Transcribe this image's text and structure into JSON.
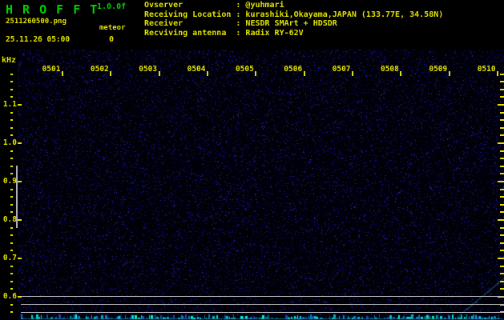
{
  "app": {
    "name": "H R O F F T",
    "version": "1.0.0f"
  },
  "capture": {
    "filename": "2511260500.png",
    "timestamp": "25.11.26 05:00",
    "meteor_label": "meteor",
    "meteor_count": "0"
  },
  "observation": {
    "separator": ":",
    "rows": [
      {
        "label": "Ovserver",
        "value": "@yuhmari"
      },
      {
        "label": "Receiving Location",
        "value": "kurashiki,Okayama,JAPAN (133.77E, 34.58N)"
      },
      {
        "label": "Receiver",
        "value": "NESDR SMArt + HDSDR"
      },
      {
        "label": "Recviving antenna",
        "value": "Radix RY-62V"
      }
    ]
  },
  "axis": {
    "unit_label": "kHz",
    "freq_ticks": [
      "1.1",
      "1.0",
      "0.9",
      "0.8",
      "0.7",
      "0.6"
    ],
    "time_ticks": [
      "0501",
      "0502",
      "0503",
      "0504",
      "0505",
      "0506",
      "0507",
      "0508",
      "0509",
      "0510"
    ]
  },
  "colors": {
    "background": "#000000",
    "text_yellow": "#e0e000",
    "text_green": "#00d000",
    "noise_blue": "#2222aa",
    "carrier_gray": "#b8b8b8",
    "level_cyan": "#00d8d8"
  },
  "chart_data": {
    "type": "heatmap",
    "title": "HROFFT radio meteor echo spectrogram 2511260500",
    "ylabel": "kHz",
    "y_ticks_khz": [
      1.1,
      1.0,
      0.9,
      0.8,
      0.7,
      0.6
    ],
    "y_range_khz": [
      0.55,
      1.19
    ],
    "x_tick_labels": [
      "0501",
      "0502",
      "0503",
      "0504",
      "0505",
      "0506",
      "0507",
      "0508",
      "0509",
      "0510"
    ],
    "time_start": "05:01",
    "time_end": "05:10",
    "date": "2025-11-26",
    "meteor_echo_count": 0,
    "carrier_lines_khz": [
      0.603,
      0.581,
      0.56
    ],
    "content_notes": [
      "uniform dark-blue background noise field, no meteor echoes visible",
      "three faint horizontal gray carrier lines near 0.6 kHz",
      "cyan noise-level bar strip along bottom edge",
      "faint diagonal blue doppler trace in bottom-right corner",
      "gray vertical level scale bar beside left axis between 0.9 and 0.8 kHz"
    ],
    "legend": "none",
    "grid": "off"
  }
}
